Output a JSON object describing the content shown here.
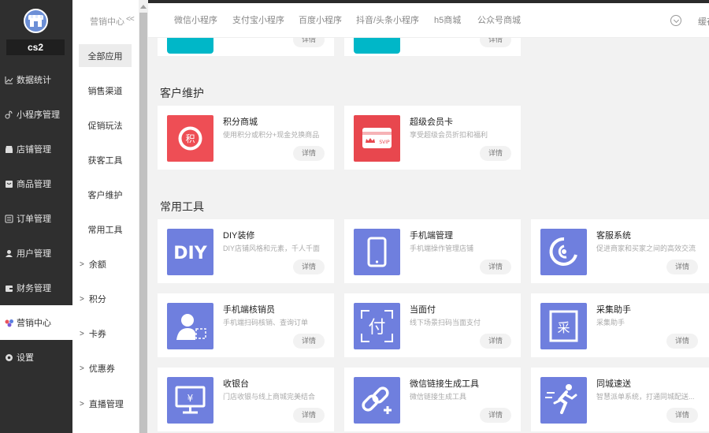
{
  "shop": {
    "name": "cs2"
  },
  "sidebar": {
    "items": [
      {
        "label": "数据统计",
        "icon": "chart-icon"
      },
      {
        "label": "小程序管理",
        "icon": "link-icon"
      },
      {
        "label": "店铺管理",
        "icon": "store-icon"
      },
      {
        "label": "商品管理",
        "icon": "goods-icon"
      },
      {
        "label": "订单管理",
        "icon": "order-icon"
      },
      {
        "label": "用户管理",
        "icon": "user-icon"
      },
      {
        "label": "财务管理",
        "icon": "finance-icon"
      },
      {
        "label": "营销中心",
        "icon": "marketing-icon"
      },
      {
        "label": "设置",
        "icon": "settings-icon"
      }
    ]
  },
  "submenu": {
    "title": "营销中心",
    "collapse": "<<",
    "items": [
      "全部应用",
      "销售渠道",
      "促销玩法",
      "获客工具",
      "客户维护",
      "常用工具"
    ],
    "tree": [
      "余额",
      "积分",
      "卡券",
      "优惠券",
      "直播管理"
    ]
  },
  "tabs": [
    "微信小程序",
    "支付宝小程序",
    "百度小程序",
    "抖音/头条小程序",
    "h5商城",
    "公众号商城"
  ],
  "topbar": {
    "cache": "缓存"
  },
  "detail_label": "详情",
  "sections": {
    "customer": {
      "title": "客户维护",
      "cards": [
        {
          "name": "积分商城",
          "desc": "使用积分或积分+现金兑换商品"
        },
        {
          "name": "超级会员卡",
          "desc": "享受超级会员折扣和福利"
        }
      ]
    },
    "tools": {
      "title": "常用工具",
      "cards": [
        {
          "name": "DIY装修",
          "desc": "DIY店铺风格和元素，千人千面"
        },
        {
          "name": "手机端管理",
          "desc": "手机端操作管理店铺"
        },
        {
          "name": "客服系统",
          "desc": "促进商家和买家之间的高效交流"
        },
        {
          "name": "手机端核销员",
          "desc": "手机端扫码核销、查询订单"
        },
        {
          "name": "当面付",
          "desc": "线下场景扫码当面支付"
        },
        {
          "name": "采集助手",
          "desc": "采集助手"
        },
        {
          "name": "收银台",
          "desc": "门店收银与线上商城完美结合"
        },
        {
          "name": "微信链接生成工具",
          "desc": "微信链接生成工具"
        },
        {
          "name": "同城速送",
          "desc": "智慧派单系统，打通同城配送..."
        }
      ]
    }
  },
  "icon_glyphs": {
    "points": "积",
    "vip": "SVIP",
    "diy": "DIY",
    "pay": "付",
    "collect": "采",
    "cashier": "¥"
  },
  "colors": {
    "accent": "#6f7fde",
    "points_red": "#ee4e55",
    "vip_red": "#e8474e",
    "teal": "#00b7c8"
  }
}
